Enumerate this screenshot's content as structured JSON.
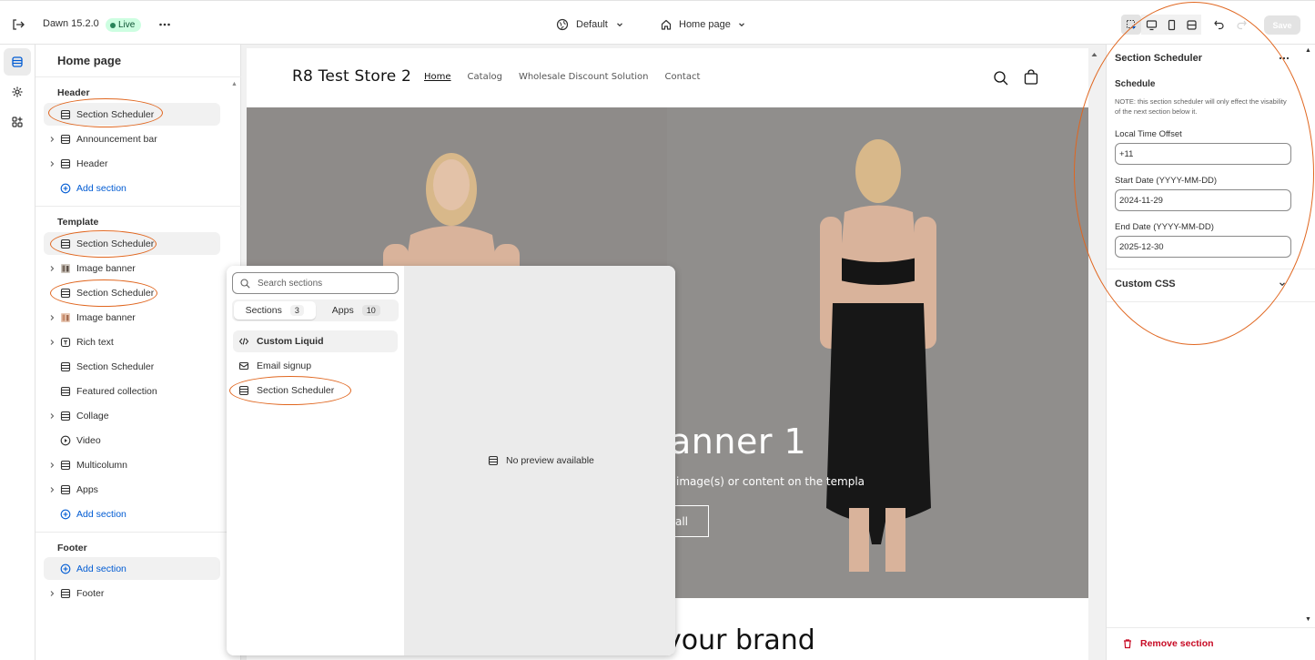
{
  "topbar": {
    "theme_name": "Dawn 15.2.0",
    "live_label": "Live",
    "template_label": "Default",
    "page_label": "Home page",
    "save_label": "Save"
  },
  "sidebar": {
    "title": "Home page",
    "header_group": "Header",
    "template_group": "Template",
    "footer_group": "Footer",
    "header_items": [
      {
        "label": "Section Scheduler"
      },
      {
        "label": "Announcement bar"
      },
      {
        "label": "Header"
      },
      {
        "label": "Add section"
      }
    ],
    "template_items": [
      {
        "label": "Section Scheduler"
      },
      {
        "label": "Image banner"
      },
      {
        "label": "Section Scheduler"
      },
      {
        "label": "Image banner"
      },
      {
        "label": "Rich text"
      },
      {
        "label": "Section Scheduler"
      },
      {
        "label": "Featured collection"
      },
      {
        "label": "Collage"
      },
      {
        "label": "Video"
      },
      {
        "label": "Multicolumn"
      },
      {
        "label": "Apps"
      },
      {
        "label": "Add section"
      }
    ],
    "footer_items": [
      {
        "label": "Add section"
      },
      {
        "label": "Footer"
      }
    ]
  },
  "store": {
    "name": "R8 Test Store 2",
    "nav": [
      "Home",
      "Catalog",
      "Wholesale Discount Solution",
      "Contact"
    ],
    "banner_heading": "anner 1",
    "banner_sub": "image(s) or content on the templa",
    "banner_button": "all",
    "below_heading": "your brand"
  },
  "picker": {
    "search_placeholder": "Search sections",
    "tabs": [
      {
        "label": "Sections",
        "count": "3"
      },
      {
        "label": "Apps",
        "count": "10"
      }
    ],
    "items": [
      {
        "label": "Custom Liquid"
      },
      {
        "label": "Email signup"
      },
      {
        "label": "Section Scheduler"
      }
    ],
    "preview_text": "No preview available"
  },
  "panel": {
    "title": "Section Scheduler",
    "heading": "Schedule",
    "note": "NOTE: this section scheduler will only effect the visability of the next section below it.",
    "fields": [
      {
        "label": "Local Time Offset",
        "value": "+11"
      },
      {
        "label": "Start Date (YYYY-MM-DD)",
        "value": "2024-11-29"
      },
      {
        "label": "End Date (YYYY-MM-DD)",
        "value": "2025-12-30"
      }
    ],
    "custom_css": "Custom CSS",
    "remove_label": "Remove section"
  },
  "colors": {
    "accent_blue": "#005bd3",
    "annotation_orange": "#e0661f",
    "live_green": "#29845a",
    "danger_red": "#c70a24"
  }
}
